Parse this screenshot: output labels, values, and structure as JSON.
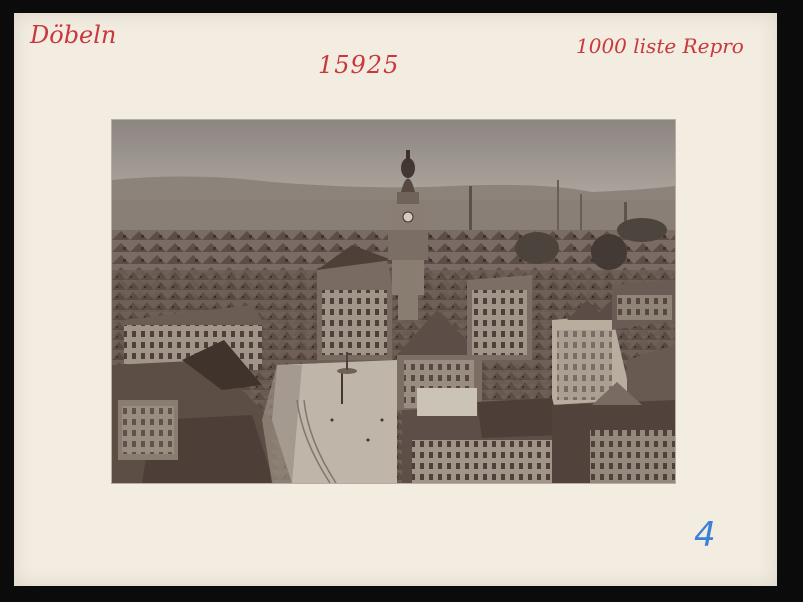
{
  "card": {
    "place_note": "Döbeln",
    "number_note": "15925",
    "price_note": "1000 liste Repro",
    "index_note": "4"
  },
  "photo": {
    "subject": "aerial town view with clock tower and market square"
  },
  "colors": {
    "mount": "#f2ece1",
    "pencil_red": "#c9383d",
    "pencil_blue": "#3b7fd6",
    "sepia_sky": "#a29c96"
  }
}
